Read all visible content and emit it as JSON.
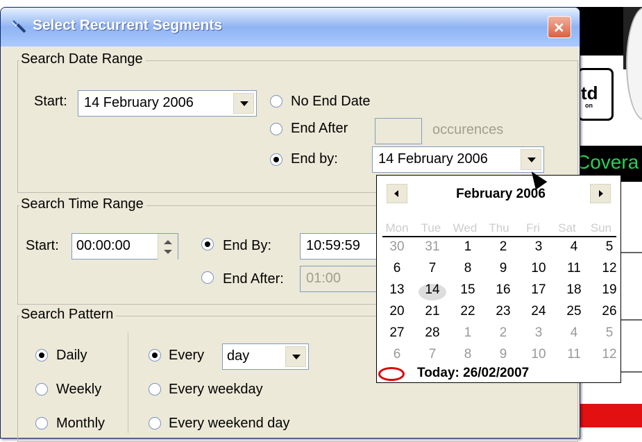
{
  "window": {
    "title": "Select Recurrent Segments",
    "close_glyph": "×",
    "icon": "wrench-icon"
  },
  "date_range": {
    "legend": "Search Date Range",
    "start_label": "Start:",
    "start_value": "14  February  2006",
    "no_end_label": "No End Date",
    "end_after_label": "End After",
    "end_after_value": "",
    "occurrences_label": "occurences",
    "end_by_label": "End by:",
    "end_by_value": "14  February  2006"
  },
  "calendar": {
    "month_label": "February 2006",
    "weekdays": [
      "Mon",
      "Tue",
      "Wed",
      "Thu",
      "Fri",
      "Sat",
      "Sun"
    ],
    "weeks": [
      [
        {
          "d": "30",
          "m": true
        },
        {
          "d": "31",
          "m": true
        },
        {
          "d": "1"
        },
        {
          "d": "2"
        },
        {
          "d": "3"
        },
        {
          "d": "4"
        },
        {
          "d": "5"
        }
      ],
      [
        {
          "d": "6"
        },
        {
          "d": "7"
        },
        {
          "d": "8"
        },
        {
          "d": "9"
        },
        {
          "d": "10"
        },
        {
          "d": "11"
        },
        {
          "d": "12"
        }
      ],
      [
        {
          "d": "13"
        },
        {
          "d": "14",
          "selected": true
        },
        {
          "d": "15"
        },
        {
          "d": "16"
        },
        {
          "d": "17"
        },
        {
          "d": "18"
        },
        {
          "d": "19"
        }
      ],
      [
        {
          "d": "20"
        },
        {
          "d": "21"
        },
        {
          "d": "22"
        },
        {
          "d": "23"
        },
        {
          "d": "24"
        },
        {
          "d": "25"
        },
        {
          "d": "26"
        }
      ],
      [
        {
          "d": "27"
        },
        {
          "d": "28"
        },
        {
          "d": "1",
          "m": true
        },
        {
          "d": "2",
          "m": true
        },
        {
          "d": "3",
          "m": true
        },
        {
          "d": "4",
          "m": true
        },
        {
          "d": "5",
          "m": true
        }
      ],
      [
        {
          "d": "6",
          "m": true
        },
        {
          "d": "7",
          "m": true
        },
        {
          "d": "8",
          "m": true
        },
        {
          "d": "9",
          "m": true
        },
        {
          "d": "10",
          "m": true
        },
        {
          "d": "11",
          "m": true
        },
        {
          "d": "12",
          "m": true
        }
      ]
    ],
    "today_label": "Today: 26/02/2007"
  },
  "time_range": {
    "legend": "Search Time Range",
    "start_label": "Start:",
    "start_value": "00:00:00",
    "end_by_label": "End By:",
    "end_by_value": "10:59:59",
    "end_after_label": "End After:",
    "end_after_value": "01:00"
  },
  "pattern": {
    "legend": "Search Pattern",
    "frequencies": [
      "Daily",
      "Weekly",
      "Monthly"
    ],
    "every_label": "Every",
    "every_value": "day",
    "every_weekday_label": "Every weekday",
    "every_weekend_label": "Every weekend day"
  },
  "background": {
    "logo_text": "td",
    "logo_small": "on",
    "band_text": "Covera"
  }
}
